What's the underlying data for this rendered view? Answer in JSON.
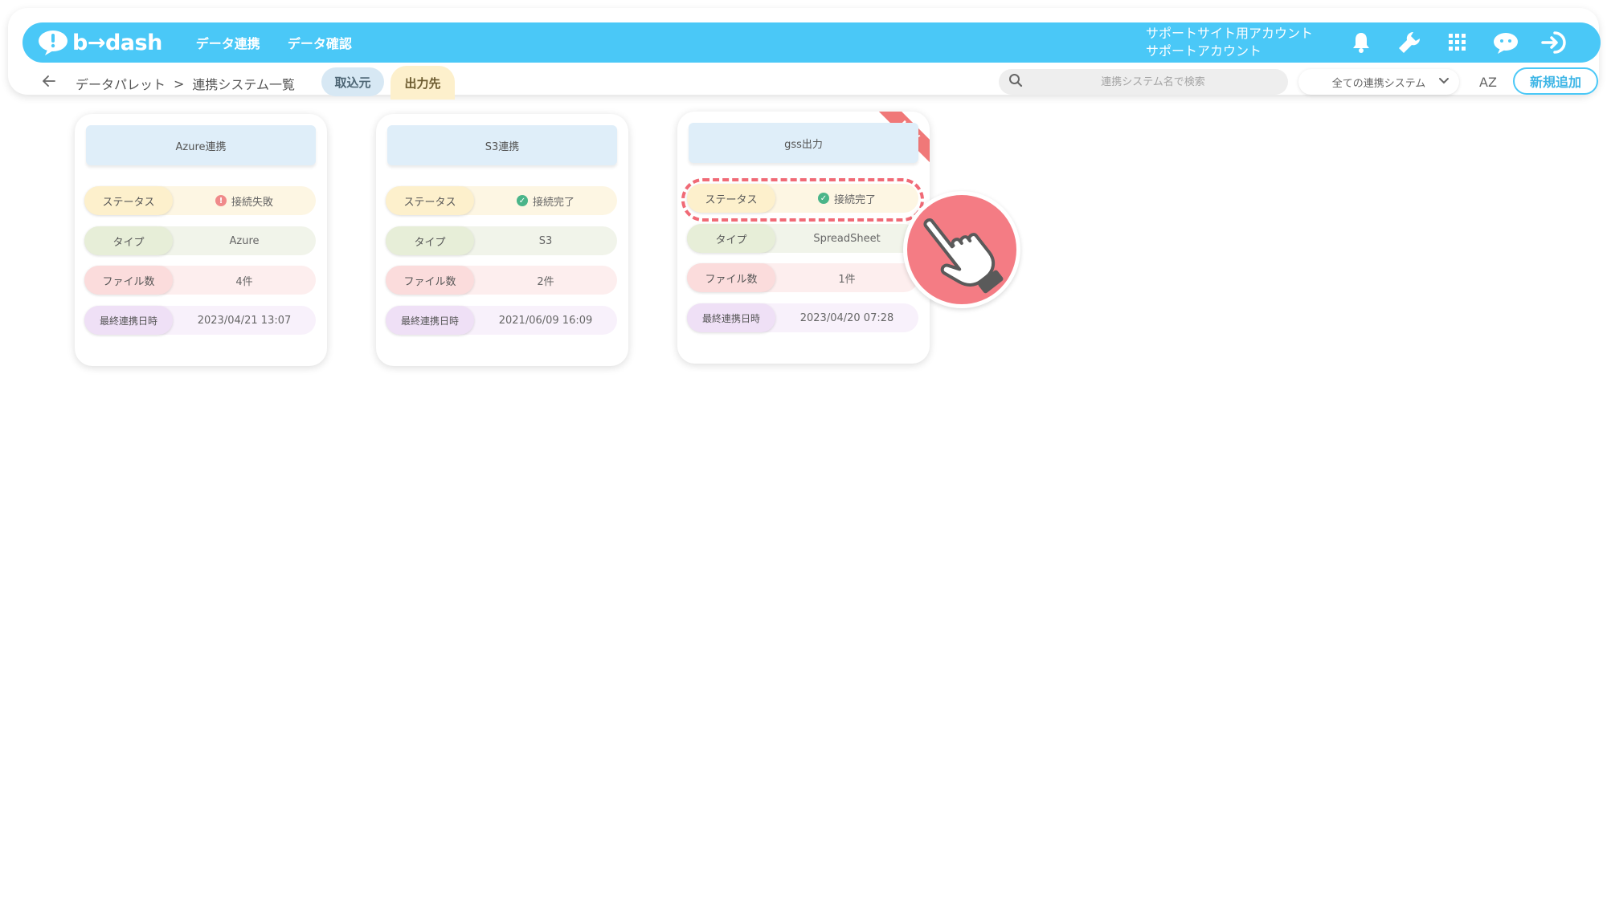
{
  "app": {
    "logo_text": "b→dash",
    "nav": [
      "データ連携",
      "データ確認"
    ],
    "account_line1": "サポートサイト用アカウント",
    "account_line2": "サポートアカウント",
    "brand_color": "#4ac8f7"
  },
  "toolbar": {
    "breadcrumb_root": "データパレット",
    "breadcrumb_sep": ">",
    "breadcrumb_current": "連携システム一覧",
    "tab_import": "取込元",
    "tab_export": "出力先",
    "active_tab": "出力先",
    "search_placeholder": "連携システム名で検索",
    "filter_value": "全ての連携システム",
    "sort_label": "AZ",
    "add_label": "新規追加"
  },
  "labels": {
    "status": "ステータス",
    "type": "タイプ",
    "files": "ファイル数",
    "last_sync": "最終連携日時"
  },
  "cards": [
    {
      "title": "Azure連携",
      "status": "接続失敗",
      "status_kind": "error",
      "type": "Azure",
      "files": "4件",
      "last_sync": "2023/04/21 13:07",
      "is_new": false
    },
    {
      "title": "S3連携",
      "status": "接続完了",
      "status_kind": "ok",
      "type": "S3",
      "files": "2件",
      "last_sync": "2021/06/09 16:09",
      "is_new": false
    },
    {
      "title": "gss出力",
      "status": "接続完了",
      "status_kind": "ok",
      "type": "SpreadSheet",
      "files": "1件",
      "last_sync": "2023/04/20 07:28",
      "is_new": true,
      "badge": "NEW"
    }
  ],
  "icons": [
    "bell-icon",
    "wrench-icon",
    "apps-grid-icon",
    "chat-bot-icon",
    "logout-icon",
    "back-arrow-icon",
    "search-icon",
    "chevron-down-icon",
    "hand-pointer-icon"
  ]
}
